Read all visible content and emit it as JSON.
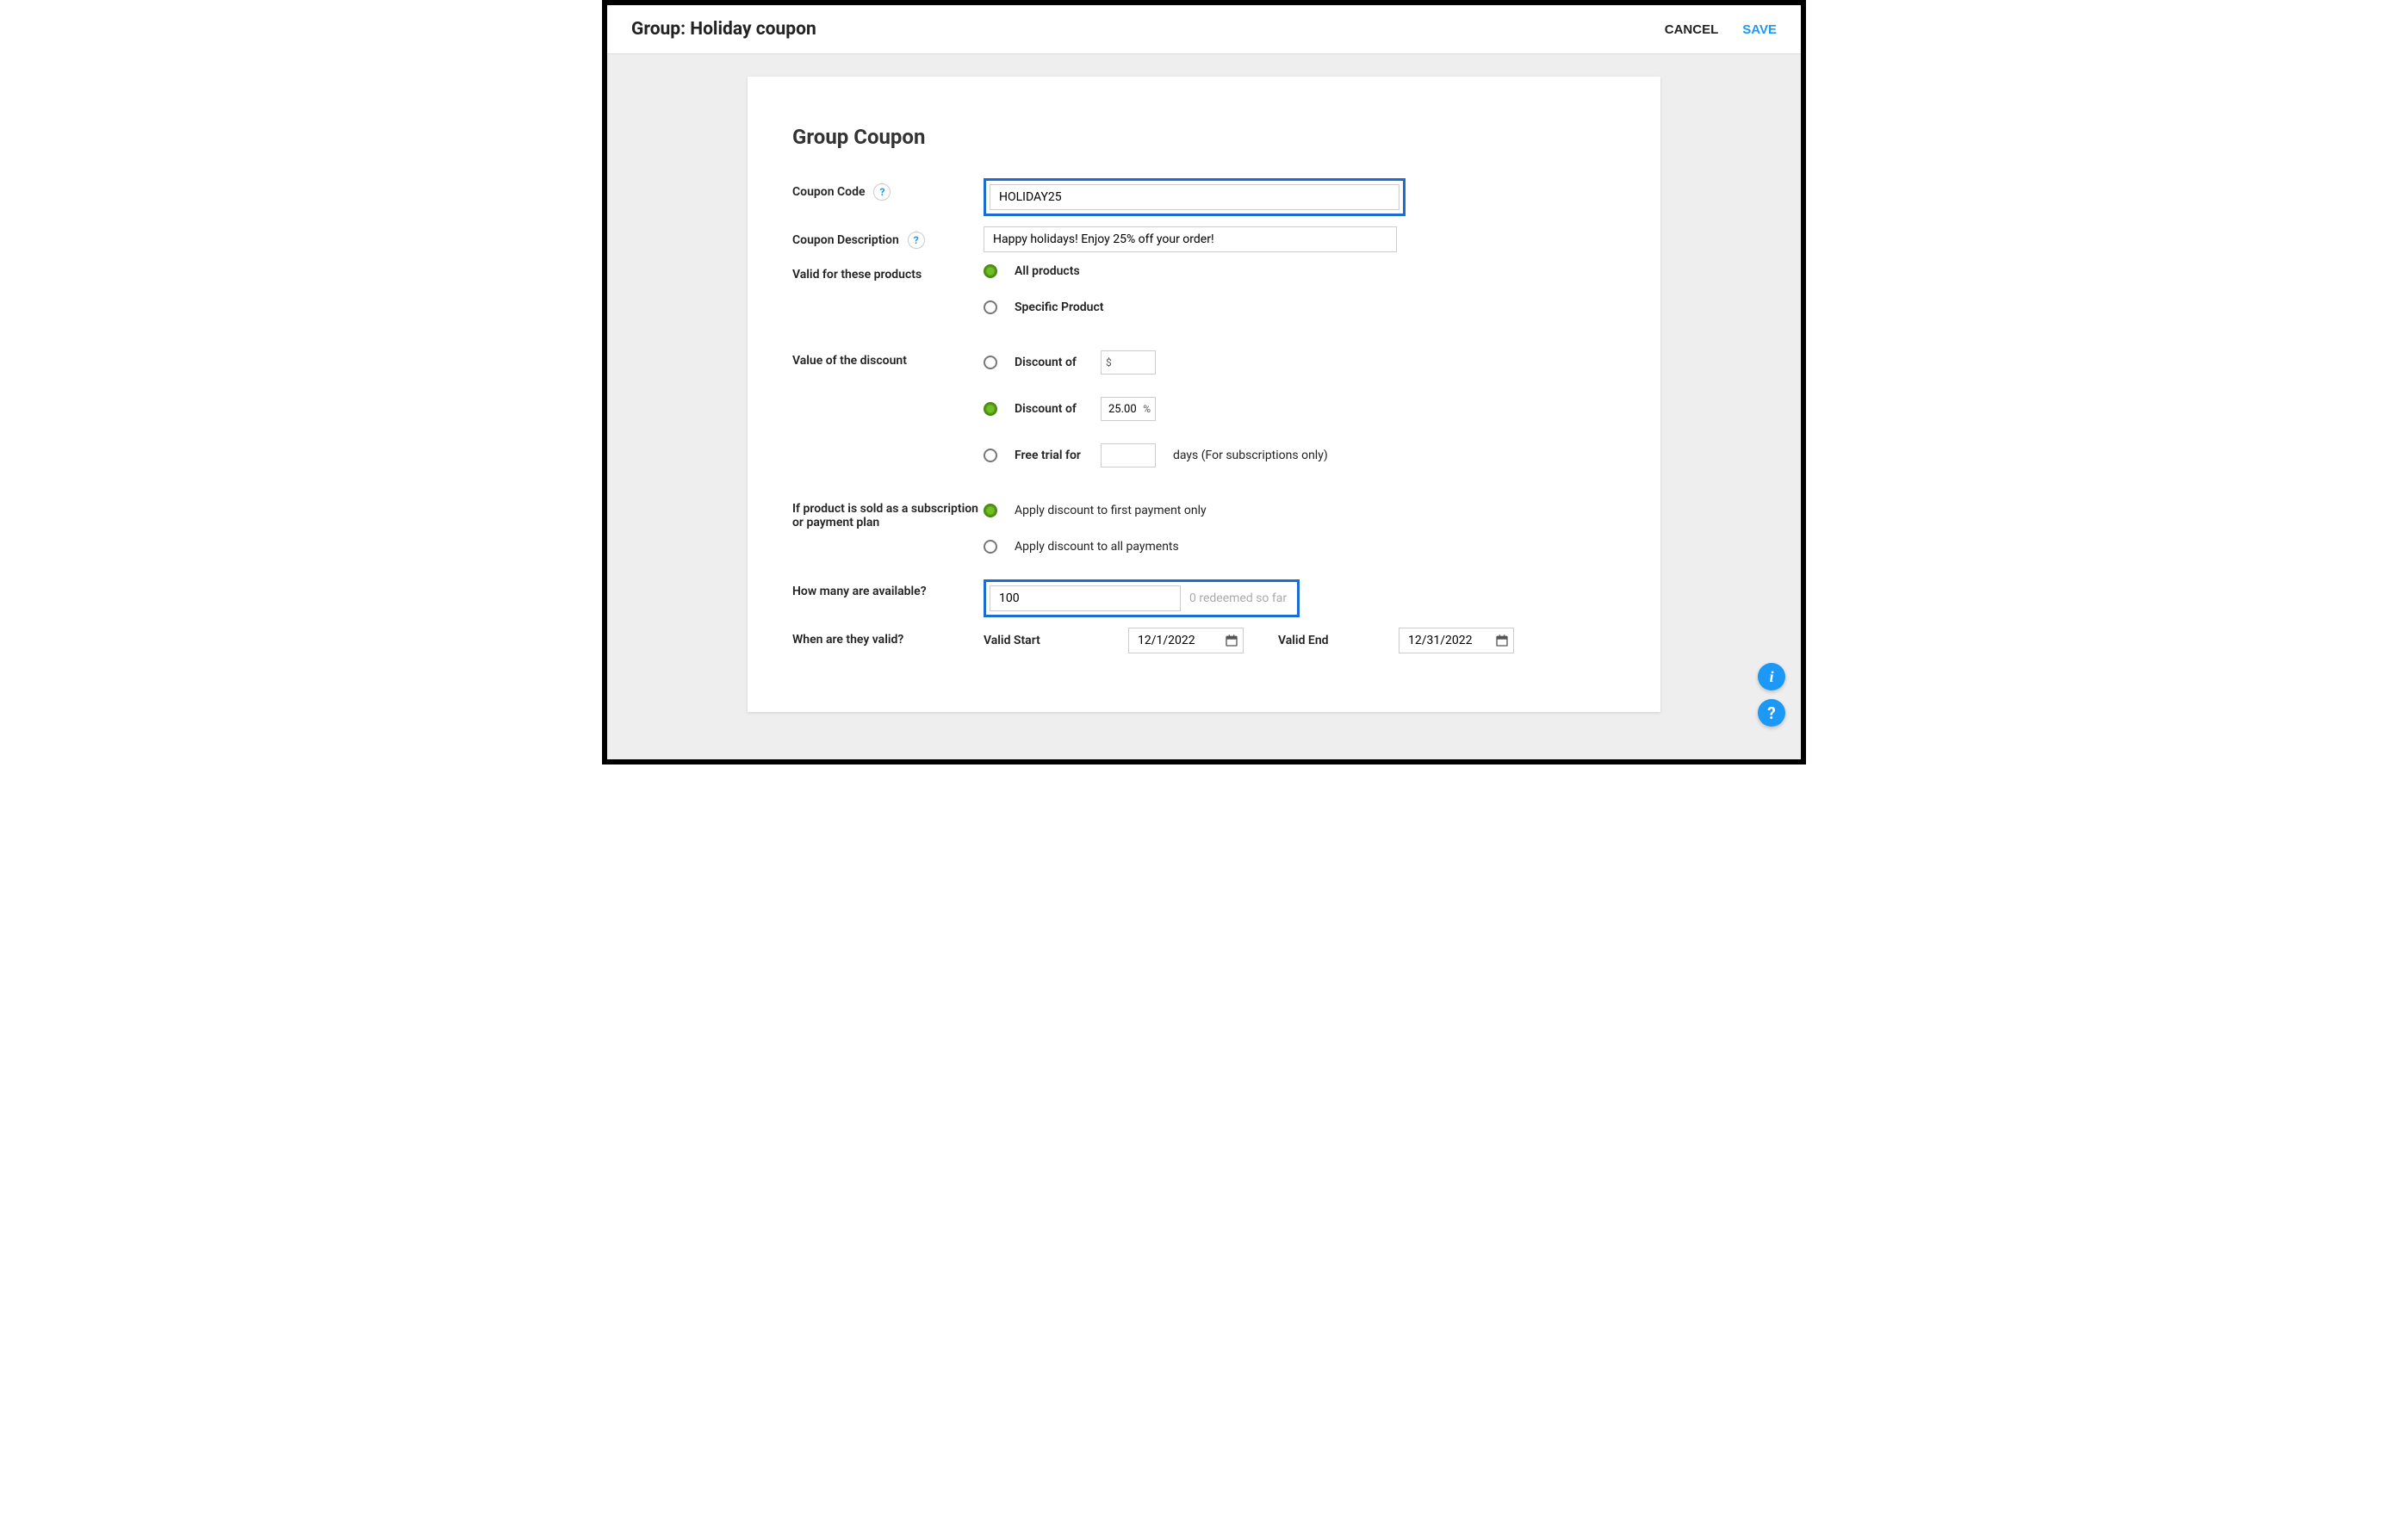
{
  "header": {
    "title": "Group: Holiday coupon",
    "cancel": "CANCEL",
    "save": "SAVE"
  },
  "card": {
    "title": "Group Coupon"
  },
  "labels": {
    "couponCode": "Coupon Code",
    "couponDescription": "Coupon Description",
    "validFor": "Valid for these products",
    "valueOfDiscount": "Value of the discount",
    "subscriptionPlan": "If product is sold as a subscription or payment plan",
    "howMany": "How many are available?",
    "whenValid": "When are they valid?",
    "validStart": "Valid Start",
    "validEnd": "Valid End"
  },
  "values": {
    "couponCode": "HOLIDAY25",
    "couponDescription": "Happy holidays! Enjoy 25% off your order!",
    "discountPercent": "25.00",
    "available": "100",
    "redeemed": "0 redeemed so far",
    "validStart": "12/1/2022",
    "validEnd": "12/31/2022"
  },
  "options": {
    "allProducts": "All products",
    "specificProduct": "Specific Product",
    "discountDollar": "Discount of",
    "dollarSymbol": "$",
    "discountPercent": "Discount of",
    "percentSymbol": "%",
    "freeTrialPrefix": "Free trial for",
    "freeTrialSuffix": "days (For subscriptions only)",
    "applyFirst": "Apply discount to first payment only",
    "applyAll": "Apply discount to all payments"
  }
}
